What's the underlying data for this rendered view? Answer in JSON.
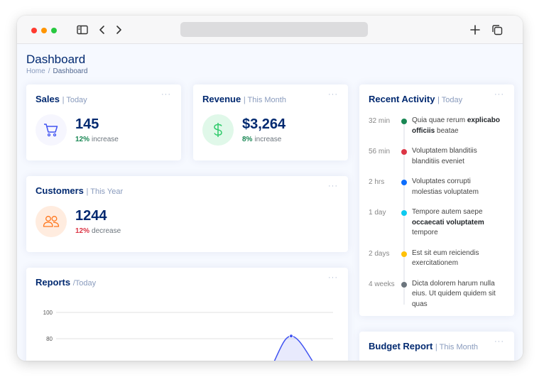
{
  "page": {
    "title": "Dashboard",
    "breadcrumb": [
      "Home",
      "/",
      "Dashboard"
    ]
  },
  "sales": {
    "title": "Sales",
    "period": "| Today",
    "value": "145",
    "pct": "12%",
    "trend": "increase",
    "icon": "cart-icon"
  },
  "revenue": {
    "title": "Revenue",
    "period": "| This Month",
    "value": "$3,264",
    "pct": "8%",
    "trend": "increase",
    "icon": "dollar-icon"
  },
  "customers": {
    "title": "Customers",
    "period": "| This Year",
    "value": "1244",
    "pct": "12%",
    "trend": "decrease",
    "icon": "people-icon"
  },
  "reports": {
    "title": "Reports",
    "period": "/Today",
    "chart_data": {
      "type": "area",
      "yticks": [
        "100",
        "80"
      ],
      "peak_value": 82,
      "series": [
        {
          "values": [
            82
          ]
        }
      ]
    }
  },
  "activity": {
    "title": "Recent Activity",
    "period": "| Today",
    "items": [
      {
        "time": "32 min",
        "pre": "Quia quae rerum ",
        "bold": "explicabo officiis",
        "post": " beatae",
        "color": "#198754"
      },
      {
        "time": "56 min",
        "pre": "Voluptatem blanditiis blanditiis eveniet",
        "bold": "",
        "post": "",
        "color": "#dc3545"
      },
      {
        "time": "2 hrs",
        "pre": "Voluptates corrupti molestias voluptatem",
        "bold": "",
        "post": "",
        "color": "#0d6efd"
      },
      {
        "time": "1 day",
        "pre": "Tempore autem saepe ",
        "bold": "occaecati voluptatem",
        "post": " tempore",
        "color": "#0dcaf0"
      },
      {
        "time": "2 days",
        "pre": "Est sit eum reiciendis exercitationem",
        "bold": "",
        "post": "",
        "color": "#ffc107"
      },
      {
        "time": "4 weeks",
        "pre": "Dicta dolorem harum nulla eius. Ut quidem quidem sit quas",
        "bold": "",
        "post": "",
        "color": "#6c757d"
      }
    ]
  },
  "budget": {
    "title": "Budget Report",
    "period": "| This Month"
  },
  "menu_glyph": "···",
  "colors": {
    "primary": "#4154f1",
    "heading": "#012970",
    "page_bg": "#f6f9ff"
  }
}
